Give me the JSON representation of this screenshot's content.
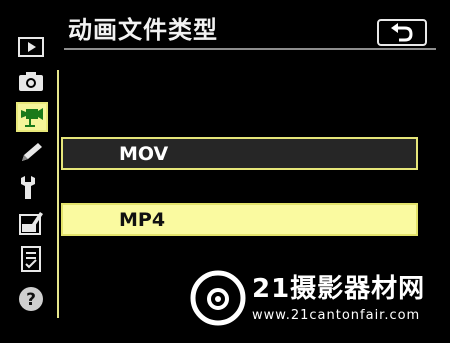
{
  "header": {
    "title": "动画文件类型",
    "back_icon": "return-arrow-icon"
  },
  "sidebar": {
    "items": [
      {
        "icon": "playback-icon",
        "active": false
      },
      {
        "icon": "camera-icon",
        "active": false
      },
      {
        "icon": "movie-camera-icon",
        "active": true
      },
      {
        "icon": "pencil-icon",
        "active": false
      },
      {
        "icon": "wrench-icon",
        "active": false
      },
      {
        "icon": "retouch-icon",
        "active": false
      },
      {
        "icon": "my-menu-icon",
        "active": false
      },
      {
        "icon": "help-icon",
        "active": false
      }
    ]
  },
  "options": [
    {
      "label": "MOV",
      "selected": false
    },
    {
      "label": "MP4",
      "selected": true
    }
  ],
  "watermark": {
    "title": "21摄影器材网",
    "url": "www.21cantonfair.com"
  },
  "colors": {
    "highlight": "#fafaa0",
    "highlight_border": "#e6e67a",
    "background": "#000000"
  }
}
